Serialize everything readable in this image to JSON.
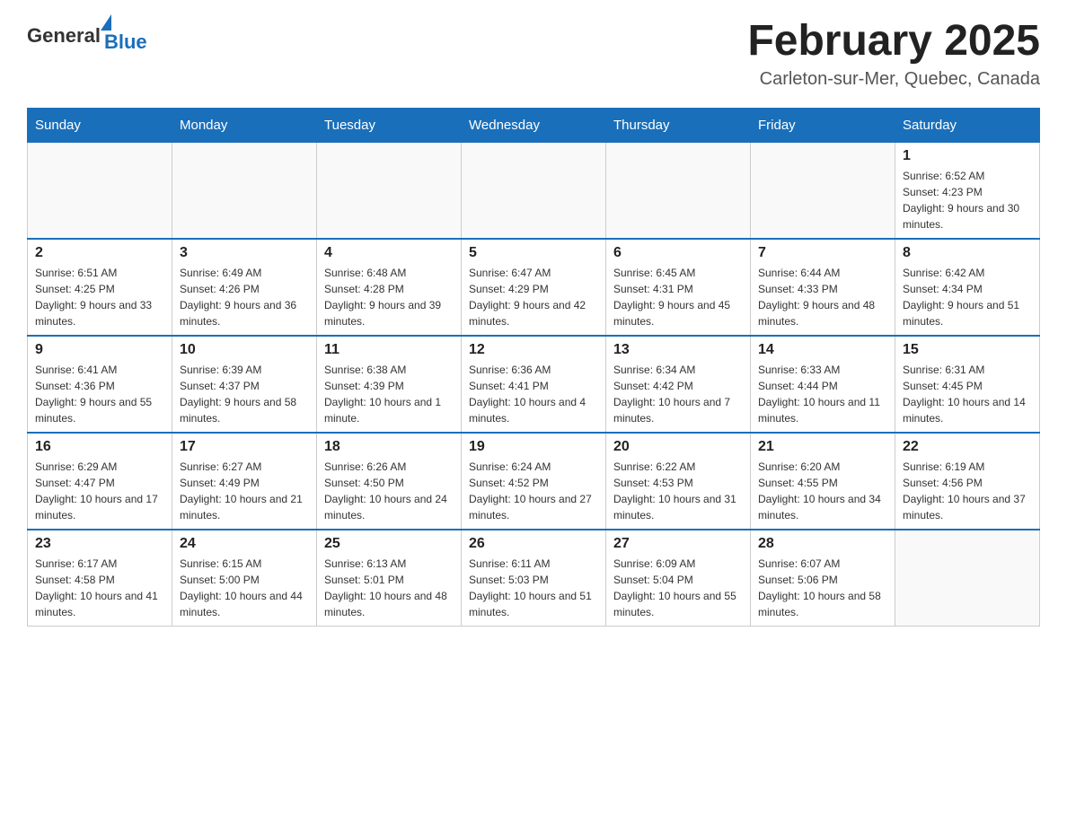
{
  "header": {
    "logo_general": "General",
    "logo_blue": "Blue",
    "month_title": "February 2025",
    "location": "Carleton-sur-Mer, Quebec, Canada"
  },
  "weekdays": [
    "Sunday",
    "Monday",
    "Tuesday",
    "Wednesday",
    "Thursday",
    "Friday",
    "Saturday"
  ],
  "weeks": [
    [
      {
        "day": "",
        "info": ""
      },
      {
        "day": "",
        "info": ""
      },
      {
        "day": "",
        "info": ""
      },
      {
        "day": "",
        "info": ""
      },
      {
        "day": "",
        "info": ""
      },
      {
        "day": "",
        "info": ""
      },
      {
        "day": "1",
        "info": "Sunrise: 6:52 AM\nSunset: 4:23 PM\nDaylight: 9 hours and 30 minutes."
      }
    ],
    [
      {
        "day": "2",
        "info": "Sunrise: 6:51 AM\nSunset: 4:25 PM\nDaylight: 9 hours and 33 minutes."
      },
      {
        "day": "3",
        "info": "Sunrise: 6:49 AM\nSunset: 4:26 PM\nDaylight: 9 hours and 36 minutes."
      },
      {
        "day": "4",
        "info": "Sunrise: 6:48 AM\nSunset: 4:28 PM\nDaylight: 9 hours and 39 minutes."
      },
      {
        "day": "5",
        "info": "Sunrise: 6:47 AM\nSunset: 4:29 PM\nDaylight: 9 hours and 42 minutes."
      },
      {
        "day": "6",
        "info": "Sunrise: 6:45 AM\nSunset: 4:31 PM\nDaylight: 9 hours and 45 minutes."
      },
      {
        "day": "7",
        "info": "Sunrise: 6:44 AM\nSunset: 4:33 PM\nDaylight: 9 hours and 48 minutes."
      },
      {
        "day": "8",
        "info": "Sunrise: 6:42 AM\nSunset: 4:34 PM\nDaylight: 9 hours and 51 minutes."
      }
    ],
    [
      {
        "day": "9",
        "info": "Sunrise: 6:41 AM\nSunset: 4:36 PM\nDaylight: 9 hours and 55 minutes."
      },
      {
        "day": "10",
        "info": "Sunrise: 6:39 AM\nSunset: 4:37 PM\nDaylight: 9 hours and 58 minutes."
      },
      {
        "day": "11",
        "info": "Sunrise: 6:38 AM\nSunset: 4:39 PM\nDaylight: 10 hours and 1 minute."
      },
      {
        "day": "12",
        "info": "Sunrise: 6:36 AM\nSunset: 4:41 PM\nDaylight: 10 hours and 4 minutes."
      },
      {
        "day": "13",
        "info": "Sunrise: 6:34 AM\nSunset: 4:42 PM\nDaylight: 10 hours and 7 minutes."
      },
      {
        "day": "14",
        "info": "Sunrise: 6:33 AM\nSunset: 4:44 PM\nDaylight: 10 hours and 11 minutes."
      },
      {
        "day": "15",
        "info": "Sunrise: 6:31 AM\nSunset: 4:45 PM\nDaylight: 10 hours and 14 minutes."
      }
    ],
    [
      {
        "day": "16",
        "info": "Sunrise: 6:29 AM\nSunset: 4:47 PM\nDaylight: 10 hours and 17 minutes."
      },
      {
        "day": "17",
        "info": "Sunrise: 6:27 AM\nSunset: 4:49 PM\nDaylight: 10 hours and 21 minutes."
      },
      {
        "day": "18",
        "info": "Sunrise: 6:26 AM\nSunset: 4:50 PM\nDaylight: 10 hours and 24 minutes."
      },
      {
        "day": "19",
        "info": "Sunrise: 6:24 AM\nSunset: 4:52 PM\nDaylight: 10 hours and 27 minutes."
      },
      {
        "day": "20",
        "info": "Sunrise: 6:22 AM\nSunset: 4:53 PM\nDaylight: 10 hours and 31 minutes."
      },
      {
        "day": "21",
        "info": "Sunrise: 6:20 AM\nSunset: 4:55 PM\nDaylight: 10 hours and 34 minutes."
      },
      {
        "day": "22",
        "info": "Sunrise: 6:19 AM\nSunset: 4:56 PM\nDaylight: 10 hours and 37 minutes."
      }
    ],
    [
      {
        "day": "23",
        "info": "Sunrise: 6:17 AM\nSunset: 4:58 PM\nDaylight: 10 hours and 41 minutes."
      },
      {
        "day": "24",
        "info": "Sunrise: 6:15 AM\nSunset: 5:00 PM\nDaylight: 10 hours and 44 minutes."
      },
      {
        "day": "25",
        "info": "Sunrise: 6:13 AM\nSunset: 5:01 PM\nDaylight: 10 hours and 48 minutes."
      },
      {
        "day": "26",
        "info": "Sunrise: 6:11 AM\nSunset: 5:03 PM\nDaylight: 10 hours and 51 minutes."
      },
      {
        "day": "27",
        "info": "Sunrise: 6:09 AM\nSunset: 5:04 PM\nDaylight: 10 hours and 55 minutes."
      },
      {
        "day": "28",
        "info": "Sunrise: 6:07 AM\nSunset: 5:06 PM\nDaylight: 10 hours and 58 minutes."
      },
      {
        "day": "",
        "info": ""
      }
    ]
  ]
}
